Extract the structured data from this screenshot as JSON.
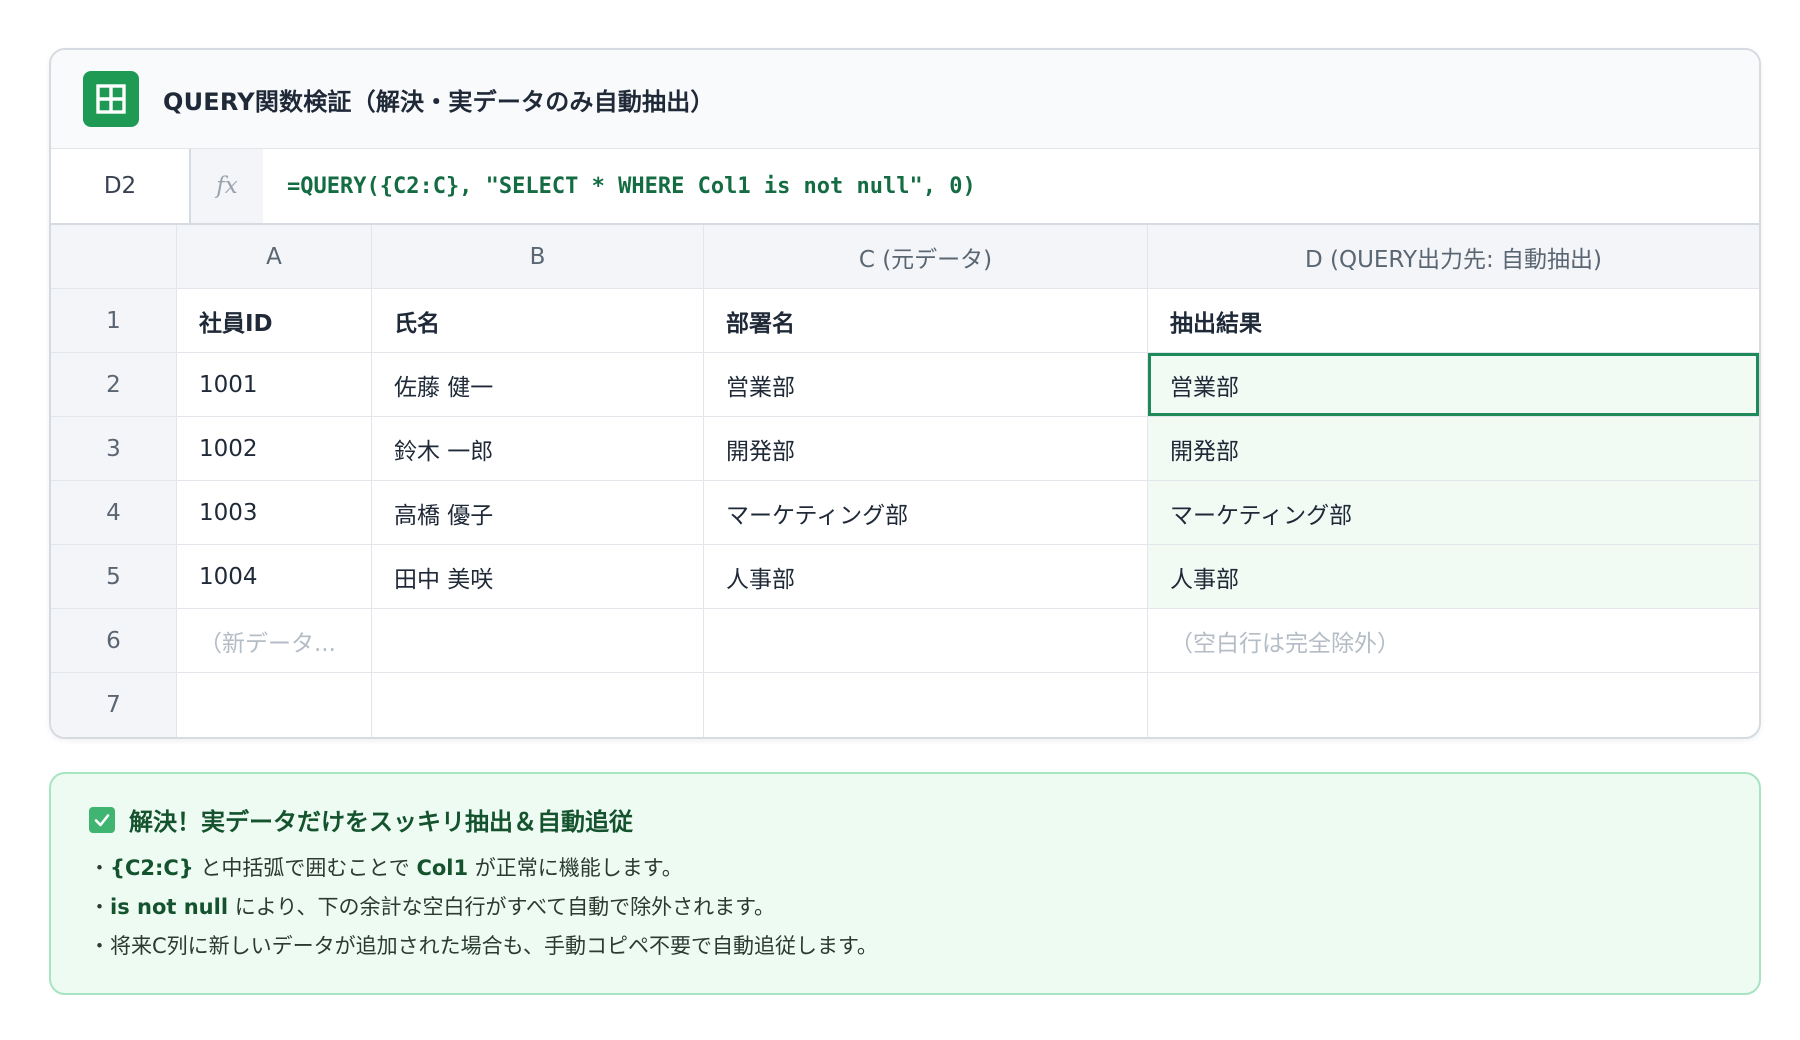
{
  "app": {
    "title": "QUERY関数検証（解決・実データのみ自動抽出）",
    "logo_icon": "google-sheets-icon",
    "accent_color": "#1e9a55"
  },
  "formula_bar": {
    "cell_ref": "D2",
    "fx_label": "fx",
    "formula": "=QUERY({C2:C}, \"SELECT * WHERE Col1 is not null\", 0)"
  },
  "grid": {
    "column_headers": [
      "A",
      "B",
      "C (元データ)",
      "D (QUERY出力先: 自動抽出)"
    ],
    "rows": [
      {
        "num": "1",
        "cells": [
          "社員ID",
          "氏名",
          "部署名",
          "抽出結果"
        ]
      },
      {
        "num": "2",
        "cells": [
          "1001",
          "佐藤 健一",
          "営業部",
          "営業部"
        ]
      },
      {
        "num": "3",
        "cells": [
          "1002",
          "鈴木 一郎",
          "開発部",
          "開発部"
        ]
      },
      {
        "num": "4",
        "cells": [
          "1003",
          "高橋 優子",
          "マーケティング部",
          "マーケティング部"
        ]
      },
      {
        "num": "5",
        "cells": [
          "1004",
          "田中 美咲",
          "人事部",
          "人事部"
        ]
      },
      {
        "num": "6",
        "cells": [
          "（新データ...",
          "",
          "",
          "（空白行は完全除外）"
        ]
      },
      {
        "num": "7",
        "cells": [
          "",
          "",
          "",
          ""
        ]
      }
    ],
    "selected_cell": "D2",
    "selection_color": "#1e8a5a"
  },
  "note": {
    "icon": "check-box-icon",
    "title": "解決！実データだけをスッキリ抽出＆自動追従",
    "line1": {
      "bullet": "・",
      "code1": "{C2:C}",
      "text1": " と中括弧で囲むことで ",
      "code2": "Col1",
      "text2": " が正常に機能します。"
    },
    "line2": {
      "bullet": "・",
      "code": "is not null",
      "text": " により、下の余計な空白行がすべて自動で除外されます。"
    },
    "line3": {
      "bullet": "・",
      "text": "将来C列に新しいデータが追加された場合も、手動コピペ不要で自動追従します。"
    }
  }
}
